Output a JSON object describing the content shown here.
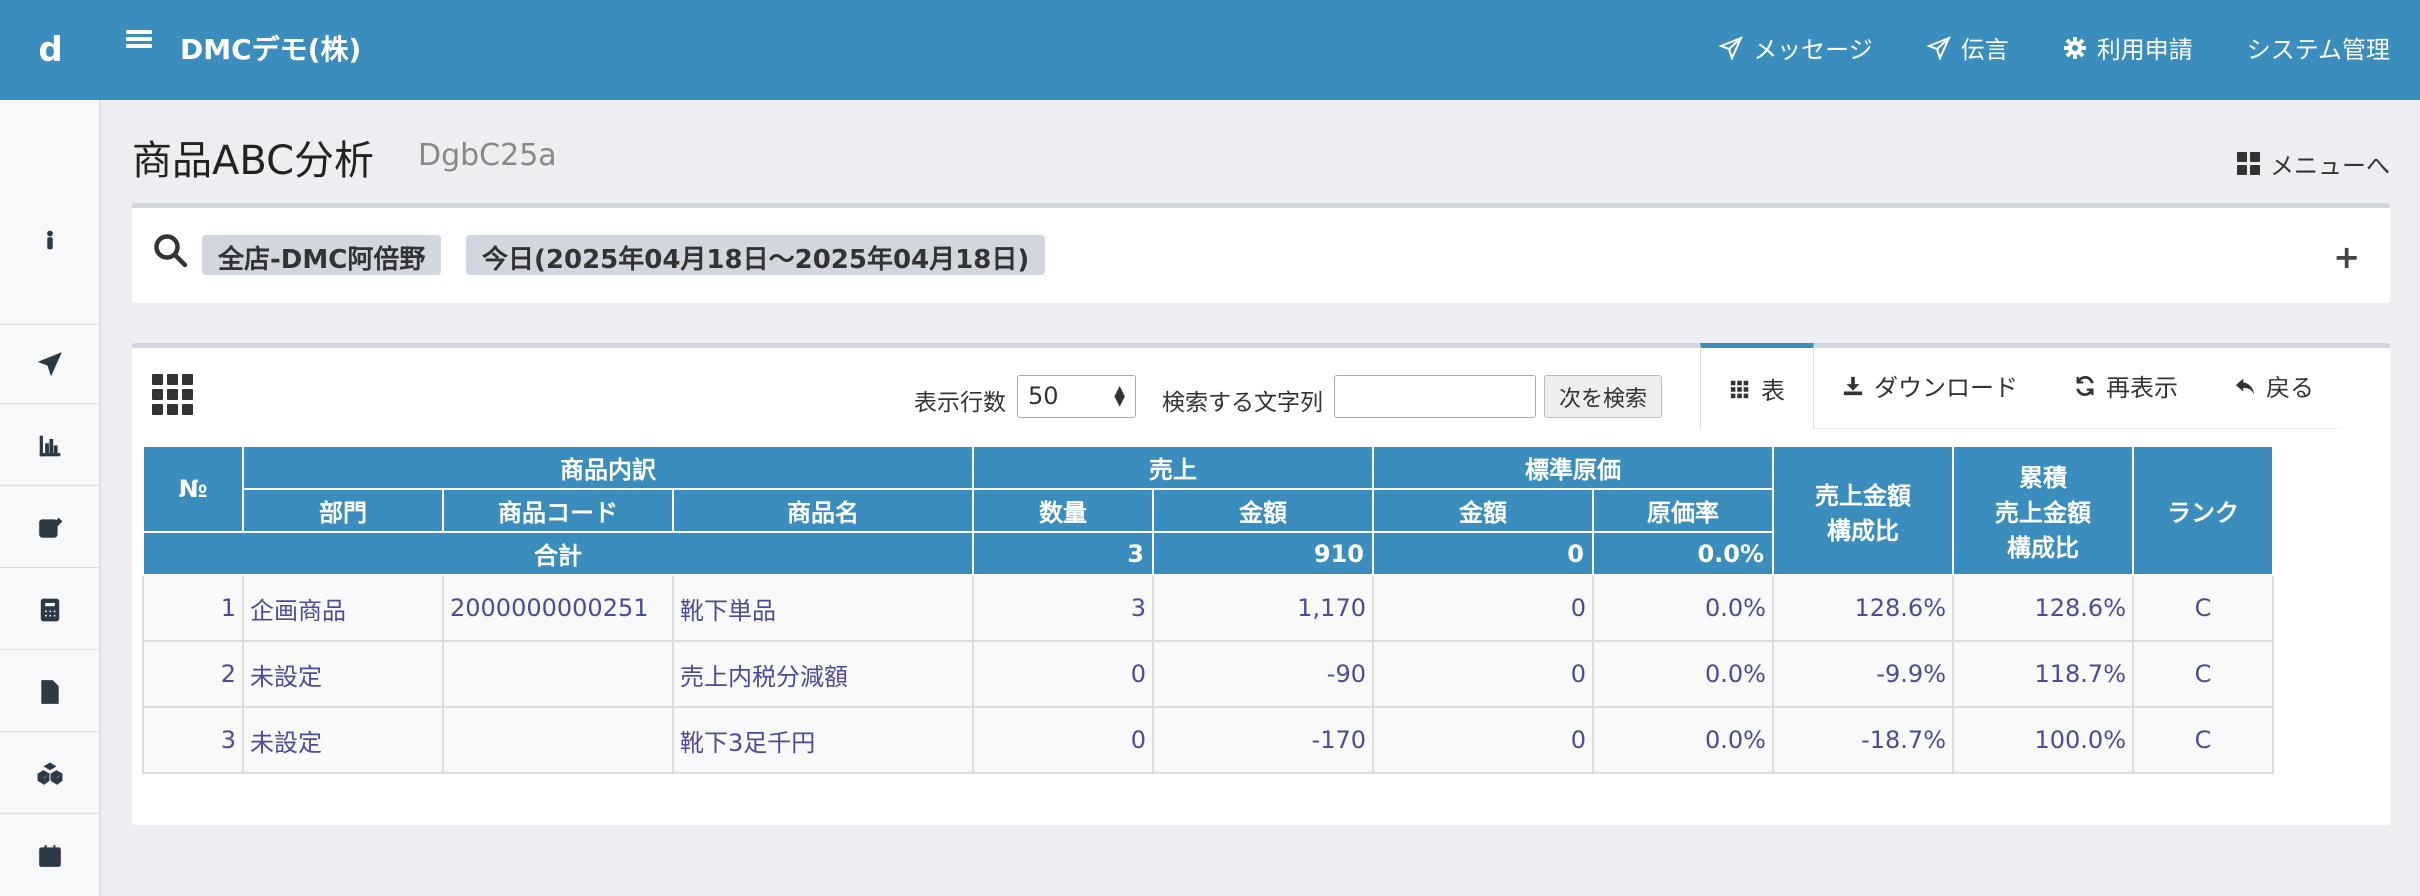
{
  "app": {
    "brand": "d",
    "company": "DMCデモ(株)"
  },
  "topnav": [
    {
      "icon": "paper-plane-icon",
      "label": "メッセージ"
    },
    {
      "icon": "paper-plane-icon",
      "label": "伝言"
    },
    {
      "icon": "gear-icon",
      "label": "利用申請"
    },
    {
      "icon": "",
      "label": "システム管理"
    }
  ],
  "sidebar": [
    "info-icon",
    "paper-plane-icon",
    "bar-chart-icon",
    "edit-icon",
    "calculator-icon",
    "document-icon",
    "cubes-icon",
    "calendar-icon"
  ],
  "page": {
    "title": "商品ABC分析",
    "subtitle": "DgbC25a",
    "menu_link": "メニューへ"
  },
  "filters": {
    "store": "全店-DMC阿倍野",
    "period": "今日(2025年04月18日〜2025年04月18日)"
  },
  "toolbar": {
    "rows_label": "表示行数",
    "rows_value": "50",
    "search_label": "検索する文字列",
    "search_value": "",
    "next_button": "次を検索",
    "tabs": [
      {
        "icon": "grid-icon",
        "label": "表"
      },
      {
        "icon": "download-icon",
        "label": "ダウンロード"
      },
      {
        "icon": "refresh-icon",
        "label": "再表示"
      },
      {
        "icon": "reply-icon",
        "label": "戻る"
      }
    ]
  },
  "table": {
    "h_no": "№",
    "h_item_group": "商品内訳",
    "h_dept": "部門",
    "h_code": "商品コード",
    "h_name": "商品名",
    "h_sales_group": "売上",
    "h_qty": "数量",
    "h_amount": "金額",
    "h_cost_group": "標準原価",
    "h_cost_amount": "金額",
    "h_cost_rate": "原価率",
    "h_ratio_l1": "売上金額",
    "h_ratio_l2": "構成比",
    "h_cum_l1": "累積",
    "h_cum_l2": "売上金額",
    "h_cum_l3": "構成比",
    "h_rank": "ランク",
    "total": {
      "label": "合計",
      "qty": "3",
      "amount": "910",
      "cost": "0",
      "cost_rate": "0.0%"
    },
    "rows": [
      {
        "no": "1",
        "dept": "企画商品",
        "code": "2000000000251",
        "name": "靴下単品",
        "qty": "3",
        "amount": "1,170",
        "cost": "0",
        "cost_rate": "0.0%",
        "ratio": "128.6%",
        "cum": "128.6%",
        "rank": "C"
      },
      {
        "no": "2",
        "dept": "未設定",
        "code": "",
        "name": "売上内税分減額",
        "qty": "0",
        "amount": "-90",
        "cost": "0",
        "cost_rate": "0.0%",
        "ratio": "-9.9%",
        "cum": "118.7%",
        "rank": "C"
      },
      {
        "no": "3",
        "dept": "未設定",
        "code": "",
        "name": "靴下3足千円",
        "qty": "0",
        "amount": "-170",
        "cost": "0",
        "cost_rate": "0.0%",
        "ratio": "-18.7%",
        "cum": "100.0%",
        "rank": "C"
      }
    ]
  },
  "colors": {
    "primary": "#3b8dbd",
    "background": "#eceef2",
    "cell_text": "#4b4b9a"
  }
}
